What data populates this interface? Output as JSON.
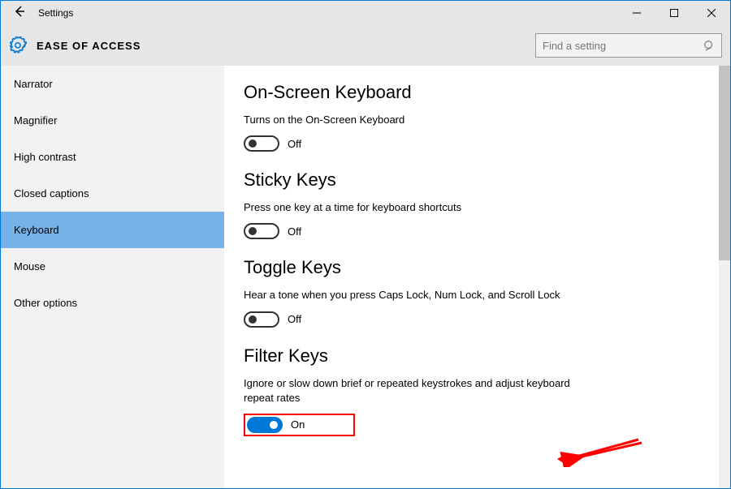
{
  "window": {
    "title": "Settings"
  },
  "header": {
    "category": "EASE OF ACCESS",
    "search_placeholder": "Find a setting"
  },
  "sidebar": {
    "items": [
      "Narrator",
      "Magnifier",
      "High contrast",
      "Closed captions",
      "Keyboard",
      "Mouse",
      "Other options"
    ],
    "selected": "Keyboard"
  },
  "sections": [
    {
      "title": "On-Screen Keyboard",
      "desc": "Turns on the On-Screen Keyboard",
      "state": "Off",
      "on": false
    },
    {
      "title": "Sticky Keys",
      "desc": "Press one key at a time for keyboard shortcuts",
      "state": "Off",
      "on": false
    },
    {
      "title": "Toggle Keys",
      "desc": "Hear a tone when you press Caps Lock, Num Lock, and Scroll Lock",
      "state": "Off",
      "on": false
    },
    {
      "title": "Filter Keys",
      "desc": "Ignore or slow down brief or repeated keystrokes and adjust keyboard repeat rates",
      "state": "On",
      "on": true,
      "highlight": true
    }
  ]
}
